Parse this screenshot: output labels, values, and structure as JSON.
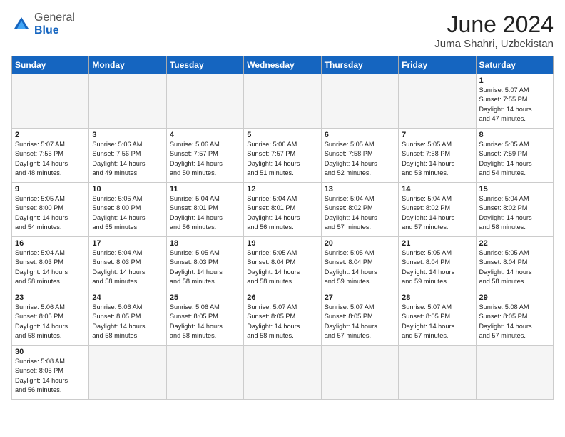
{
  "header": {
    "logo_general": "General",
    "logo_blue": "Blue",
    "month_title": "June 2024",
    "location": "Juma Shahri, Uzbekistan"
  },
  "weekdays": [
    "Sunday",
    "Monday",
    "Tuesday",
    "Wednesday",
    "Thursday",
    "Friday",
    "Saturday"
  ],
  "weeks": [
    [
      {
        "day": "",
        "info": ""
      },
      {
        "day": "",
        "info": ""
      },
      {
        "day": "",
        "info": ""
      },
      {
        "day": "",
        "info": ""
      },
      {
        "day": "",
        "info": ""
      },
      {
        "day": "",
        "info": ""
      },
      {
        "day": "1",
        "info": "Sunrise: 5:07 AM\nSunset: 7:55 PM\nDaylight: 14 hours\nand 47 minutes."
      }
    ],
    [
      {
        "day": "2",
        "info": "Sunrise: 5:07 AM\nSunset: 7:55 PM\nDaylight: 14 hours\nand 48 minutes."
      },
      {
        "day": "3",
        "info": "Sunrise: 5:06 AM\nSunset: 7:56 PM\nDaylight: 14 hours\nand 49 minutes."
      },
      {
        "day": "4",
        "info": "Sunrise: 5:06 AM\nSunset: 7:57 PM\nDaylight: 14 hours\nand 50 minutes."
      },
      {
        "day": "5",
        "info": "Sunrise: 5:06 AM\nSunset: 7:57 PM\nDaylight: 14 hours\nand 51 minutes."
      },
      {
        "day": "6",
        "info": "Sunrise: 5:05 AM\nSunset: 7:58 PM\nDaylight: 14 hours\nand 52 minutes."
      },
      {
        "day": "7",
        "info": "Sunrise: 5:05 AM\nSunset: 7:58 PM\nDaylight: 14 hours\nand 53 minutes."
      },
      {
        "day": "8",
        "info": "Sunrise: 5:05 AM\nSunset: 7:59 PM\nDaylight: 14 hours\nand 54 minutes."
      }
    ],
    [
      {
        "day": "9",
        "info": "Sunrise: 5:05 AM\nSunset: 8:00 PM\nDaylight: 14 hours\nand 54 minutes."
      },
      {
        "day": "10",
        "info": "Sunrise: 5:05 AM\nSunset: 8:00 PM\nDaylight: 14 hours\nand 55 minutes."
      },
      {
        "day": "11",
        "info": "Sunrise: 5:04 AM\nSunset: 8:01 PM\nDaylight: 14 hours\nand 56 minutes."
      },
      {
        "day": "12",
        "info": "Sunrise: 5:04 AM\nSunset: 8:01 PM\nDaylight: 14 hours\nand 56 minutes."
      },
      {
        "day": "13",
        "info": "Sunrise: 5:04 AM\nSunset: 8:02 PM\nDaylight: 14 hours\nand 57 minutes."
      },
      {
        "day": "14",
        "info": "Sunrise: 5:04 AM\nSunset: 8:02 PM\nDaylight: 14 hours\nand 57 minutes."
      },
      {
        "day": "15",
        "info": "Sunrise: 5:04 AM\nSunset: 8:02 PM\nDaylight: 14 hours\nand 58 minutes."
      }
    ],
    [
      {
        "day": "16",
        "info": "Sunrise: 5:04 AM\nSunset: 8:03 PM\nDaylight: 14 hours\nand 58 minutes."
      },
      {
        "day": "17",
        "info": "Sunrise: 5:04 AM\nSunset: 8:03 PM\nDaylight: 14 hours\nand 58 minutes."
      },
      {
        "day": "18",
        "info": "Sunrise: 5:05 AM\nSunset: 8:03 PM\nDaylight: 14 hours\nand 58 minutes."
      },
      {
        "day": "19",
        "info": "Sunrise: 5:05 AM\nSunset: 8:04 PM\nDaylight: 14 hours\nand 58 minutes."
      },
      {
        "day": "20",
        "info": "Sunrise: 5:05 AM\nSunset: 8:04 PM\nDaylight: 14 hours\nand 59 minutes."
      },
      {
        "day": "21",
        "info": "Sunrise: 5:05 AM\nSunset: 8:04 PM\nDaylight: 14 hours\nand 59 minutes."
      },
      {
        "day": "22",
        "info": "Sunrise: 5:05 AM\nSunset: 8:04 PM\nDaylight: 14 hours\nand 58 minutes."
      }
    ],
    [
      {
        "day": "23",
        "info": "Sunrise: 5:06 AM\nSunset: 8:05 PM\nDaylight: 14 hours\nand 58 minutes."
      },
      {
        "day": "24",
        "info": "Sunrise: 5:06 AM\nSunset: 8:05 PM\nDaylight: 14 hours\nand 58 minutes."
      },
      {
        "day": "25",
        "info": "Sunrise: 5:06 AM\nSunset: 8:05 PM\nDaylight: 14 hours\nand 58 minutes."
      },
      {
        "day": "26",
        "info": "Sunrise: 5:07 AM\nSunset: 8:05 PM\nDaylight: 14 hours\nand 58 minutes."
      },
      {
        "day": "27",
        "info": "Sunrise: 5:07 AM\nSunset: 8:05 PM\nDaylight: 14 hours\nand 57 minutes."
      },
      {
        "day": "28",
        "info": "Sunrise: 5:07 AM\nSunset: 8:05 PM\nDaylight: 14 hours\nand 57 minutes."
      },
      {
        "day": "29",
        "info": "Sunrise: 5:08 AM\nSunset: 8:05 PM\nDaylight: 14 hours\nand 57 minutes."
      }
    ],
    [
      {
        "day": "30",
        "info": "Sunrise: 5:08 AM\nSunset: 8:05 PM\nDaylight: 14 hours\nand 56 minutes."
      },
      {
        "day": "",
        "info": ""
      },
      {
        "day": "",
        "info": ""
      },
      {
        "day": "",
        "info": ""
      },
      {
        "day": "",
        "info": ""
      },
      {
        "day": "",
        "info": ""
      },
      {
        "day": "",
        "info": ""
      }
    ]
  ]
}
